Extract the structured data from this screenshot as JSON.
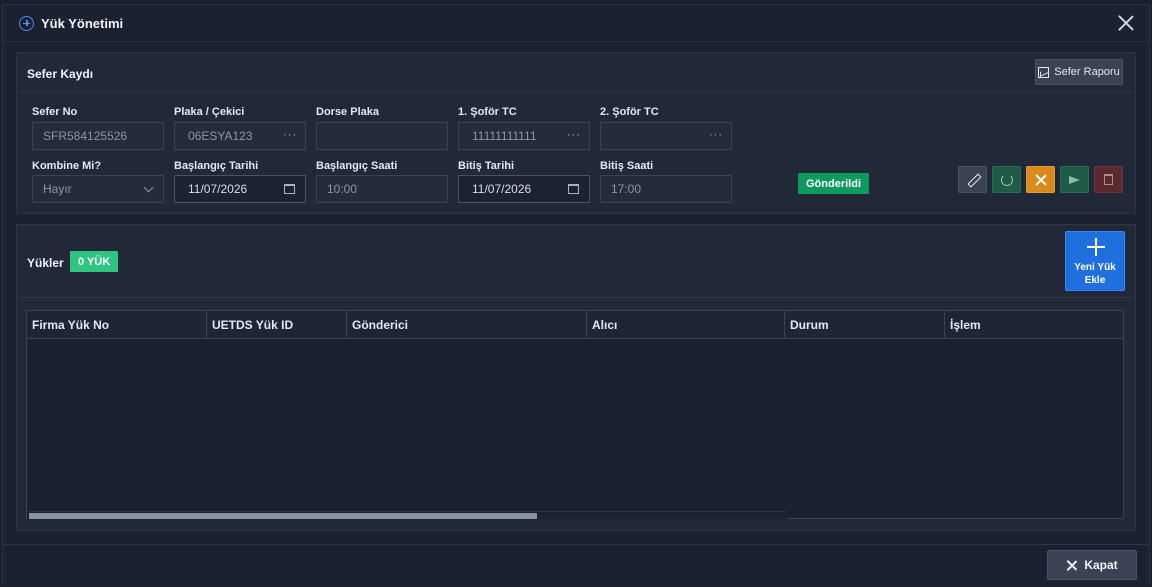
{
  "dialog": {
    "title": "Yük Yönetimi"
  },
  "trip": {
    "section_title": "Sefer Kaydı",
    "report_button": "Sefer Raporu",
    "fields": {
      "sefer_no": {
        "label": "Sefer No",
        "value": "SFR584125526"
      },
      "plaka": {
        "label": "Plaka / Çekici",
        "value": "06ESYA123"
      },
      "dorse": {
        "label": "Dorse Plaka",
        "value": ""
      },
      "sofor1": {
        "label": "1. Şoför TC",
        "value": "11111111111"
      },
      "sofor2": {
        "label": "2. Şoför TC",
        "value": ""
      },
      "kombine": {
        "label": "Kombine Mi?",
        "value": "Hayır"
      },
      "bas_tarih": {
        "label": "Başlangıç Tarihi",
        "value": "11/07/2026"
      },
      "bas_saat": {
        "label": "Başlangıç Saati",
        "value": "10:00"
      },
      "bit_tarih": {
        "label": "Bitiş Tarihi",
        "value": "11/07/2026"
      },
      "bit_saat": {
        "label": "Bitiş Saati",
        "value": "17:00"
      }
    },
    "ellipsis": "···",
    "status": "Gönderildi",
    "colors": {
      "status": "#0e9a5f",
      "edit": "#3a4253",
      "refresh": "#1f5b47",
      "cancel": "#d98a1c",
      "send": "#1f5b47",
      "delete": "#5a2a30"
    }
  },
  "loads": {
    "section_title": "Yükler",
    "count_badge": "0 YÜK",
    "new_button": "Yeni Yük Ekle",
    "columns": [
      "Firma Yük No",
      "UETDS Yük ID",
      "Gönderici",
      "Alıcı",
      "Durum",
      "İşlem"
    ],
    "rows": []
  },
  "footer": {
    "close_button": "Kapat"
  }
}
